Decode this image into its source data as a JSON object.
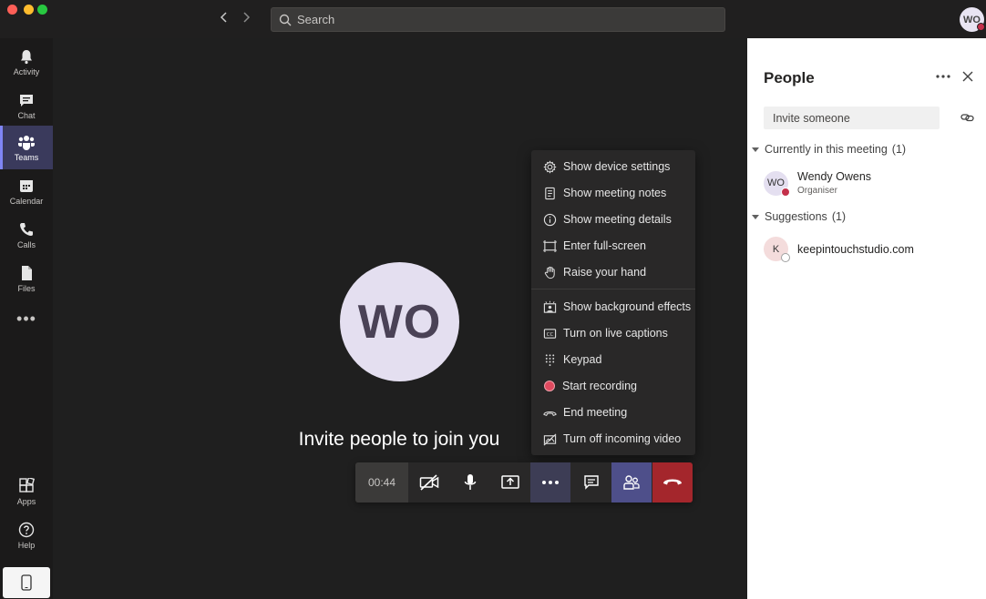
{
  "titlebar": {
    "search_placeholder": "Search",
    "user_initials": "WO"
  },
  "rail": {
    "items": [
      {
        "label": "Activity",
        "icon": "bell-icon"
      },
      {
        "label": "Chat",
        "icon": "chat-icon"
      },
      {
        "label": "Teams",
        "icon": "teams-icon",
        "active": true
      },
      {
        "label": "Calendar",
        "icon": "calendar-icon"
      },
      {
        "label": "Calls",
        "icon": "phone-icon"
      },
      {
        "label": "Files",
        "icon": "file-icon"
      }
    ],
    "more": "•••",
    "bottom": [
      {
        "label": "Apps",
        "icon": "apps-icon"
      },
      {
        "label": "Help",
        "icon": "help-icon"
      }
    ]
  },
  "stage": {
    "avatar_initials": "WO",
    "invite_text": "Invite people to join you"
  },
  "menu": {
    "items": [
      {
        "label": "Show device settings",
        "icon": "gear-icon"
      },
      {
        "label": "Show meeting notes",
        "icon": "notes-icon"
      },
      {
        "label": "Show meeting details",
        "icon": "info-icon"
      },
      {
        "label": "Enter full-screen",
        "icon": "fullscreen-icon"
      },
      {
        "label": "Raise your hand",
        "icon": "hand-icon"
      },
      {
        "label": "Show background effects",
        "icon": "background-effects-icon"
      },
      {
        "label": "Turn on live captions",
        "icon": "captions-icon"
      },
      {
        "label": "Keypad",
        "icon": "keypad-icon"
      },
      {
        "label": "Start recording",
        "icon": "record-icon"
      },
      {
        "label": "End meeting",
        "icon": "end-meeting-icon"
      },
      {
        "label": "Turn off incoming video",
        "icon": "video-off-icon"
      }
    ]
  },
  "controls": {
    "timer": "00:44"
  },
  "panel": {
    "title": "People",
    "invite_placeholder": "Invite someone",
    "current_section": {
      "label": "Currently in this meeting",
      "count": "(1)"
    },
    "suggestions_section": {
      "label": "Suggestions",
      "count": "(1)"
    },
    "participants": [
      {
        "initials": "WO",
        "name": "Wendy Owens",
        "role": "Organiser"
      }
    ],
    "suggestions": [
      {
        "initials": "K",
        "name": "keepintouchstudio.com"
      }
    ]
  },
  "colors": {
    "accent": "#4e4f8a",
    "hangup": "#a4262c",
    "status_busy": "#c4314b",
    "record": "#e04a5f"
  }
}
